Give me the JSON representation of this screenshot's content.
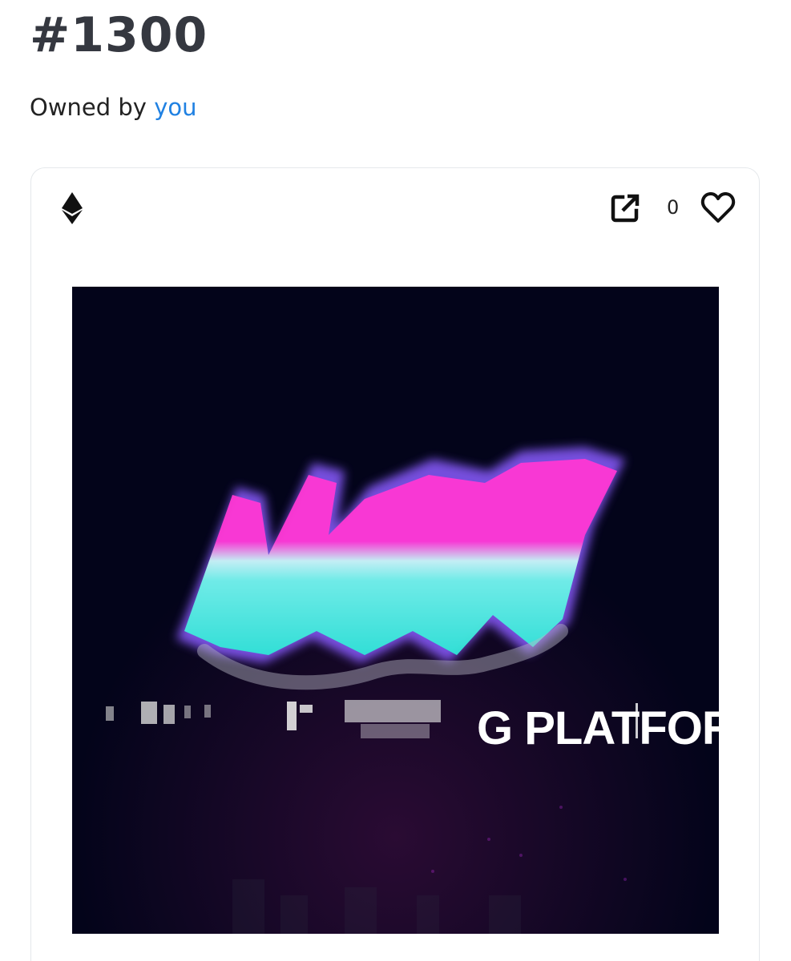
{
  "item": {
    "title": "#1300",
    "owner_prefix": "Owned by",
    "owner_name": "you"
  },
  "card": {
    "chain_icon": "ethereum-icon",
    "external_icon": "external-link-icon",
    "like_icon": "heart-outline-icon",
    "like_count": "0"
  },
  "artwork": {
    "logo_text": "NFA",
    "tagline_text": "G PLATFOR",
    "colors": {
      "background": "#03041a",
      "pink": "#ff37d4",
      "cyan": "#6ff3e8",
      "purple": "#8a5bff"
    }
  },
  "theme": {
    "text": "#353840",
    "link": "#2081e2",
    "border": "#e5e8eb"
  }
}
